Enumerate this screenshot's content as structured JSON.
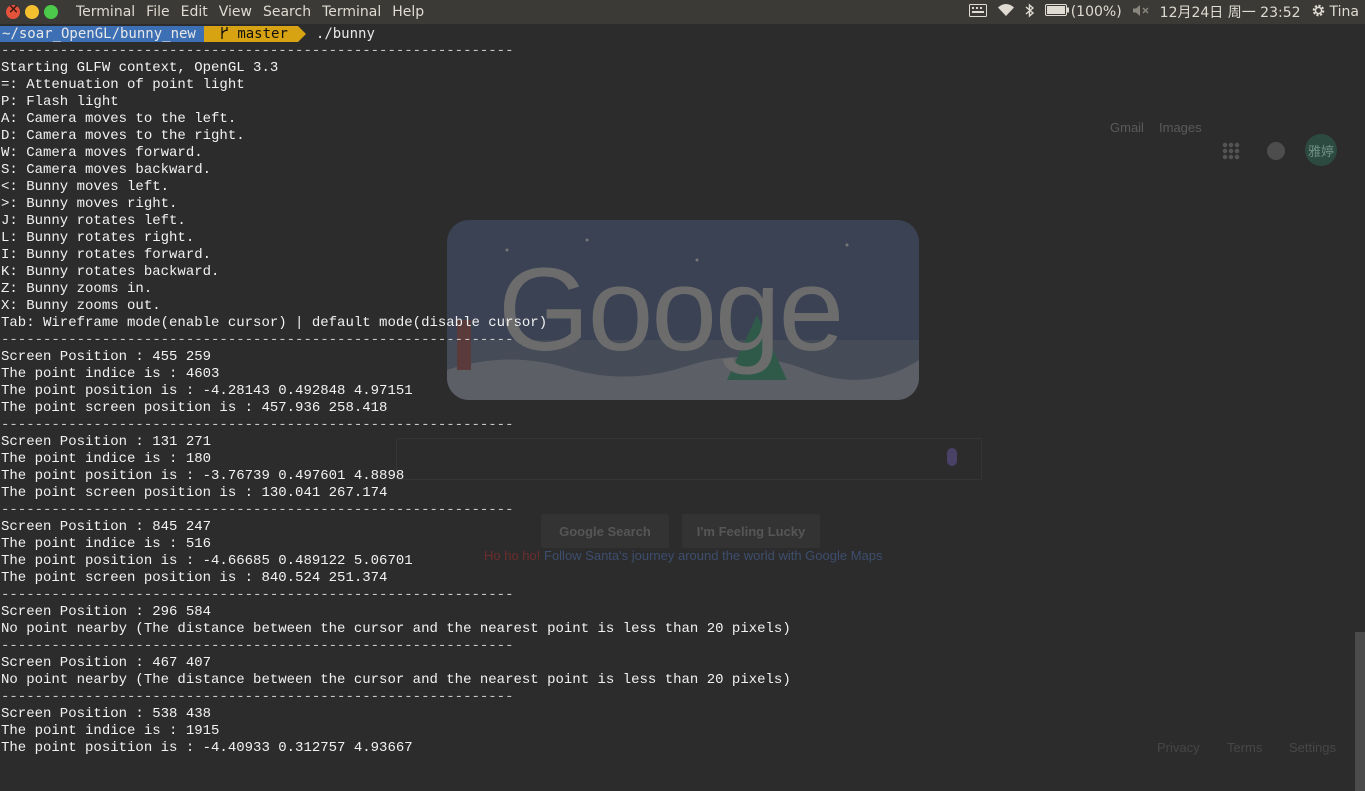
{
  "topbar": {
    "menu": [
      "Terminal",
      "File",
      "Edit",
      "View",
      "Search",
      "Terminal",
      "Help"
    ],
    "battery": "(100%)",
    "datetime": "12月24日 周一 23:52",
    "user": "Tina",
    "icons": [
      "keyboard-icon",
      "wifi-icon",
      "bluetooth-icon",
      "battery-icon",
      "volume-mute-icon",
      "gear-icon"
    ]
  },
  "prompt": {
    "path": "~/soar_OpenGL/bunny_new",
    "branch": "master",
    "command": "./bunny"
  },
  "terminal_lines": [
    {
      "text": "-------------------------------------------------------------",
      "sep": true
    },
    {
      "text": "Starting GLFW context, OpenGL 3.3"
    },
    {
      "text": "=: Attenuation of point light"
    },
    {
      "text": "P: Flash light"
    },
    {
      "text": "A: Camera moves to the left."
    },
    {
      "text": "D: Camera moves to the right."
    },
    {
      "text": "W: Camera moves forward."
    },
    {
      "text": "S: Camera moves backward."
    },
    {
      "text": "<: Bunny moves left."
    },
    {
      "text": ">: Bunny moves right."
    },
    {
      "text": "J: Bunny rotates left."
    },
    {
      "text": "L: Bunny rotates right."
    },
    {
      "text": "I: Bunny rotates forward."
    },
    {
      "text": "K: Bunny rotates backward."
    },
    {
      "text": "Z: Bunny zooms in."
    },
    {
      "text": "X: Bunny zooms out."
    },
    {
      "text": "Tab: Wireframe mode(enable cursor) | default mode(disable cursor)"
    },
    {
      "text": "-------------------------------------------------------------",
      "sep": true
    },
    {
      "text": "Screen Position : 455 259"
    },
    {
      "text": "The point indice is : 4603"
    },
    {
      "text": "The point position is : -4.28143 0.492848 4.97151"
    },
    {
      "text": "The point screen position is : 457.936 258.418"
    },
    {
      "text": "-------------------------------------------------------------",
      "sep": true
    },
    {
      "text": "Screen Position : 131 271"
    },
    {
      "text": "The point indice is : 180"
    },
    {
      "text": "The point position is : -3.76739 0.497601 4.8898"
    },
    {
      "text": "The point screen position is : 130.041 267.174"
    },
    {
      "text": "-------------------------------------------------------------",
      "sep": true
    },
    {
      "text": "Screen Position : 845 247"
    },
    {
      "text": "The point indice is : 516"
    },
    {
      "text": "The point position is : -4.66685 0.489122 5.06701"
    },
    {
      "text": "The point screen position is : 840.524 251.374"
    },
    {
      "text": "-------------------------------------------------------------",
      "sep": true
    },
    {
      "text": "Screen Position : 296 584"
    },
    {
      "text": "No point nearby (The distance between the cursor and the nearest point is less than 20 pixels)"
    },
    {
      "text": "-------------------------------------------------------------",
      "sep": true
    },
    {
      "text": "Screen Position : 467 407"
    },
    {
      "text": "No point nearby (The distance between the cursor and the nearest point is less than 20 pixels)"
    },
    {
      "text": "-------------------------------------------------------------",
      "sep": true
    },
    {
      "text": "Screen Position : 538 438"
    },
    {
      "text": "The point indice is : 1915"
    },
    {
      "text": "The point position is : -4.40933 0.312757 4.93667"
    }
  ],
  "background_browser": {
    "header_links": [
      "Gmail",
      "Images"
    ],
    "avatar_text": "雅婷",
    "doodle_text": "Googe",
    "buttons": [
      "Google Search",
      "I'm Feeling Lucky"
    ],
    "promo_red": "Ho ho ho!",
    "promo_link": "Follow Santa's journey around the world with Google Maps",
    "footer_links": [
      "Privacy",
      "Terms",
      "Settings"
    ]
  }
}
